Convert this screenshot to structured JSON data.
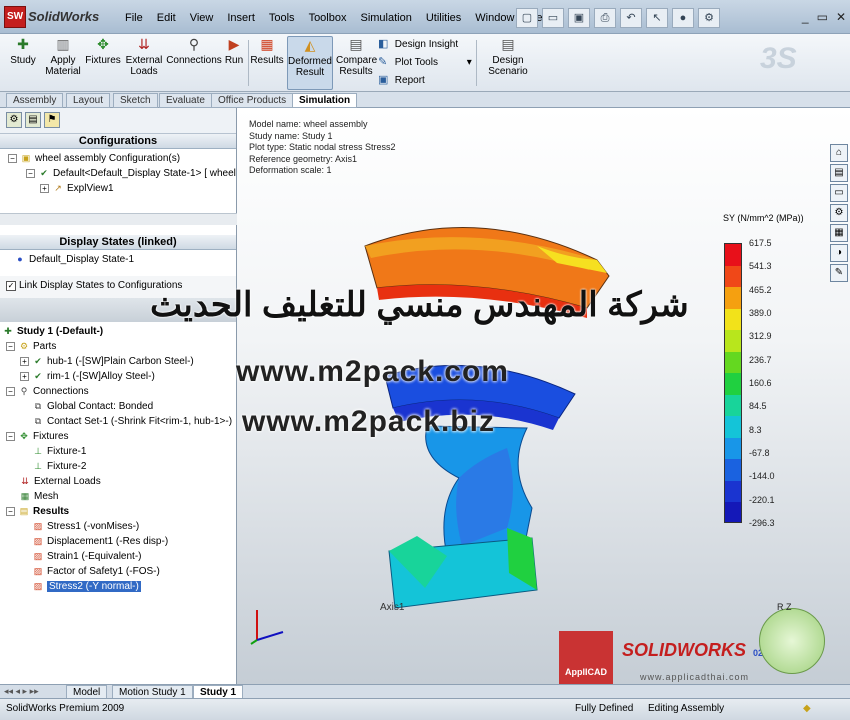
{
  "app": {
    "brand": "SolidWorks",
    "logo_text": "SW"
  },
  "menu": [
    "File",
    "Edit",
    "View",
    "Insert",
    "Tools",
    "Toolbox",
    "Simulation",
    "Utilities",
    "Window",
    "Help"
  ],
  "toolbar_icons": [
    "new-icon",
    "open-icon",
    "save-icon",
    "print-icon",
    "undo-icon",
    "select-icon",
    "rebuild-icon",
    "options-icon"
  ],
  "ribbon": {
    "study": "Study",
    "apply_material": "Apply Material",
    "fixtures": "Fixtures",
    "external_loads": "External Loads",
    "connections": "Connections",
    "run": "Run",
    "results": "Results",
    "deformed_result": "Deformed Result",
    "compare_results": "Compare Results",
    "design_insight": "Design Insight",
    "plot_tools": "Plot Tools",
    "report": "Report",
    "design_scenario": "Design Scenario"
  },
  "command_tabs": [
    "Assembly",
    "Layout",
    "Sketch",
    "Evaluate",
    "Office Products",
    "Simulation"
  ],
  "active_tab": "Simulation",
  "panel": {
    "configurations_header": "Configurations",
    "config_root": "wheel assembly Configuration(s)",
    "config_default": "Default<Default_Display State-1> [ wheel",
    "explview": "ExplView1",
    "display_states_header": "Display States (linked)",
    "display_state": "Default_Display State-1",
    "link_label": "Link Display States to Configurations",
    "study": "Study 1 (-Default-)",
    "parts": "Parts",
    "part1": "hub-1 (-[SW]Plain Carbon Steel-)",
    "part2": "rim-1 (-[SW]Alloy Steel-)",
    "connections": "Connections",
    "global_contact": "Global Contact: Bonded",
    "contact_set": "Contact Set-1 (-Shrink Fit<rim-1, hub-1>-)",
    "fixtures": "Fixtures",
    "fixture1": "Fixture-1",
    "fixture2": "Fixture-2",
    "external_loads": "External Loads",
    "mesh": "Mesh",
    "results": "Results",
    "r1": "Stress1 (-vonMises-)",
    "r2": "Displacement1 (-Res disp-)",
    "r3": "Strain1 (-Equivalent-)",
    "r4": "Factor of Safety1 (-FOS-)",
    "r5": "Stress2 (-Y normal-)"
  },
  "viewport": {
    "model_name": "Model name: wheel assembly",
    "study_name": "Study name: Study 1",
    "plot_type": "Plot type: Static nodal stress Stress2",
    "reference": "Reference geometry: Axis1",
    "deformation": "Deformation scale: 1",
    "legend_title": "SY (N/mm^2 (MPa))",
    "legend_values": [
      "617.5",
      "541.3",
      "465.2",
      "389.0",
      "312.9",
      "236.7",
      "160.6",
      "84.5",
      "8.3",
      "-67.8",
      "-144.0",
      "-220.1",
      "-296.3"
    ],
    "legend_colors": [
      "#e8101a",
      "#f04818",
      "#f5a010",
      "#f2e21a",
      "#b8e61c",
      "#64d820",
      "#20d040",
      "#18d49a",
      "#14c4d8",
      "#1896e8",
      "#1a62e0",
      "#1a34d0",
      "#1418b8"
    ],
    "axis_label": "Axis1",
    "watermark_arabic": "شركة المهندس منسي للتغليف الحديث",
    "url1": "www.m2pack.com",
    "url2": "www.m2pack.biz",
    "applicad": "ApplICAD",
    "sw_logo": "SOLIDWORKS",
    "sw_site": "www.applicadthai.com",
    "sw_phone": "02-7-8 0 1 3"
  },
  "bottom_tabs": [
    "Model",
    "Motion Study 1",
    "Study 1"
  ],
  "status": {
    "product": "SolidWorks Premium 2009",
    "defined": "Fully Defined",
    "mode": "Editing Assembly"
  }
}
